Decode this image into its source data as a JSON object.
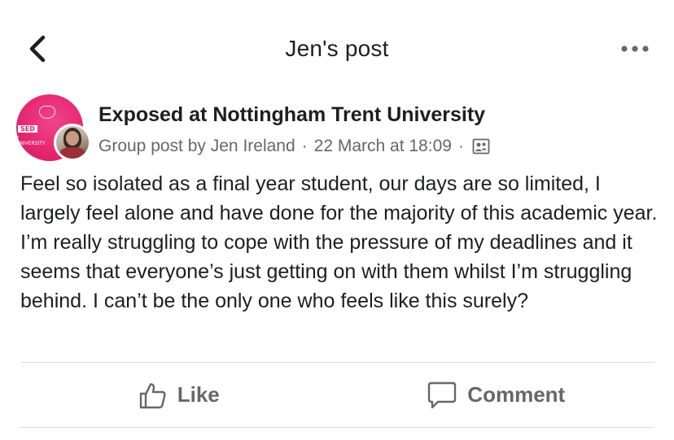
{
  "header": {
    "title": "Jen's post",
    "back_icon": "chevron-left-icon",
    "more_icon": "more-horizontal-icon"
  },
  "post": {
    "group_name": "Exposed at Nottingham Trent University",
    "group_avatar_text": "SED",
    "group_avatar_subtext": "T UNIVERSITY",
    "meta_prefix": "Group post by",
    "author": "Jen Ireland",
    "date": "22 March at 18:09",
    "separator": "·",
    "privacy_icon": "group-members-icon",
    "text": "Feel so isolated as a final year student, our days are so limited, I largely feel alone and have done for the majority of this academic year. I’m really struggling to cope with the pressure of my deadlines and it seems that everyone’s just getting on with them whilst I’m struggling behind. I can’t be the only one who feels like this surely?"
  },
  "actions": {
    "like_label": "Like",
    "comment_label": "Comment"
  },
  "colors": {
    "text_primary": "#1c1e21",
    "text_secondary": "#65676b",
    "divider": "#d9dadc",
    "group_avatar": "#e5266f"
  }
}
